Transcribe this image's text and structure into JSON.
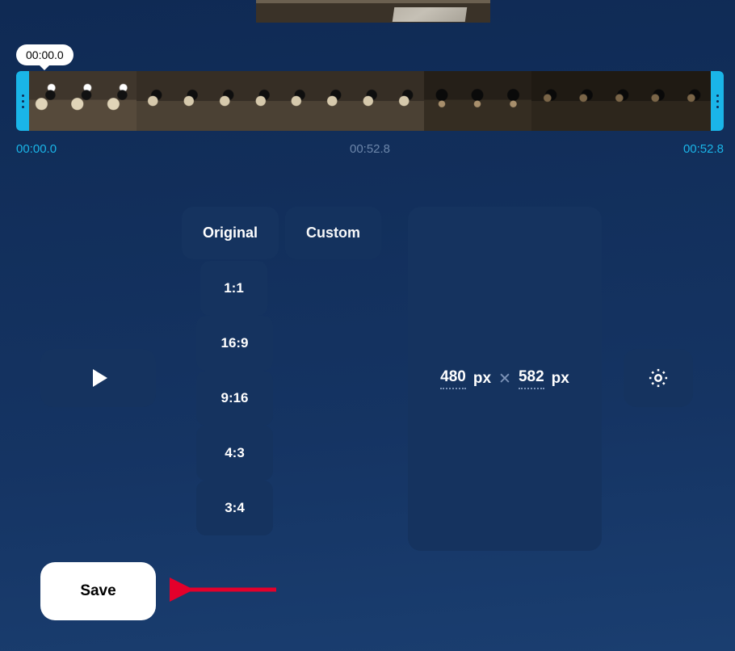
{
  "playhead_badge": "00:00.0",
  "timeline": {
    "start": "00:00.0",
    "mid": "00:52.8",
    "end": "00:52.8"
  },
  "tabs": {
    "original": "Original",
    "custom": "Custom"
  },
  "ratios": {
    "r1": "1:1",
    "r2": "16:9",
    "r3": "9:16",
    "r4": "4:3",
    "r5": "3:4"
  },
  "dimensions": {
    "width": "480",
    "height": "582",
    "unit": "px",
    "sep": "✕"
  },
  "save_label": "Save"
}
